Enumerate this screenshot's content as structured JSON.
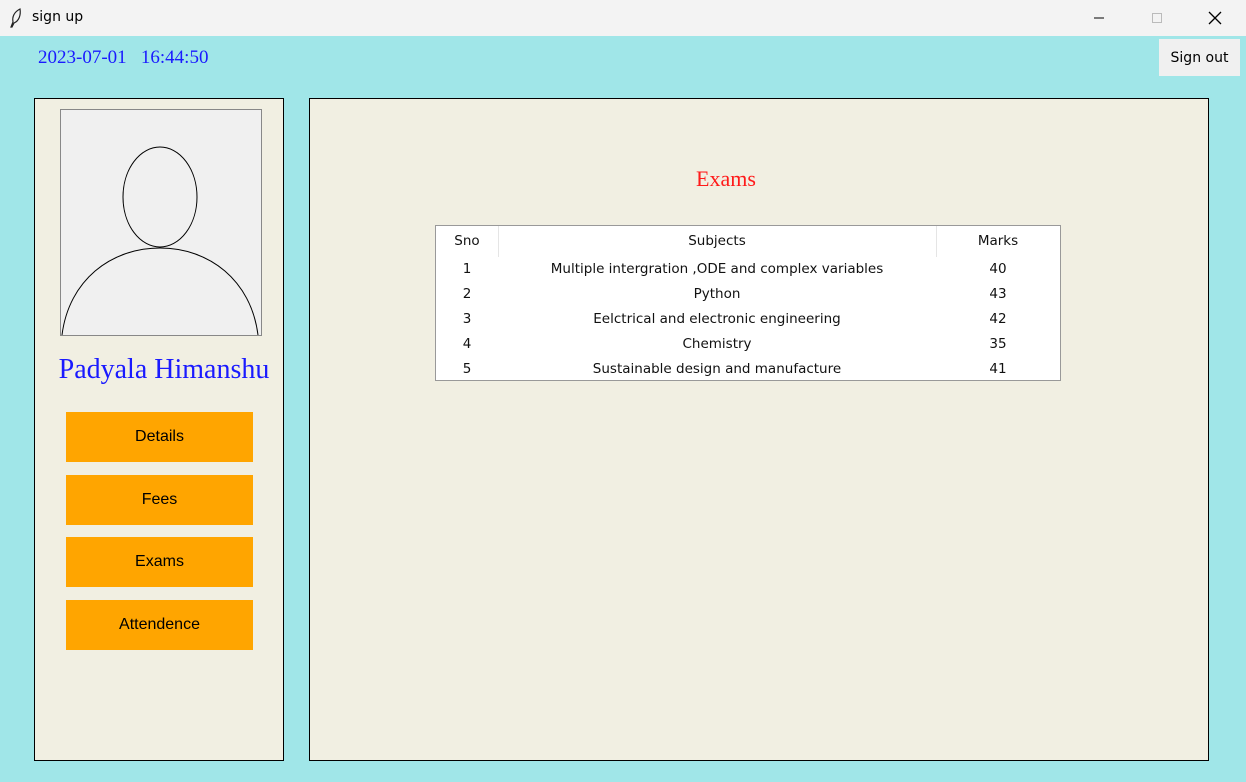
{
  "window": {
    "title": "sign up"
  },
  "header": {
    "date": "2023-07-01",
    "time": "16:44:50",
    "signout_label": "Sign out"
  },
  "sidebar": {
    "user_name": "Padyala Himanshu",
    "buttons": [
      {
        "label": "Details"
      },
      {
        "label": "Fees"
      },
      {
        "label": "Exams"
      },
      {
        "label": "Attendence"
      }
    ]
  },
  "main": {
    "title": "Exams",
    "table": {
      "headers": [
        "Sno",
        "Subjects",
        "Marks"
      ],
      "rows": [
        [
          "1",
          "Multiple intergration ,ODE and complex variables",
          "40"
        ],
        [
          "2",
          "Python",
          "43"
        ],
        [
          "3",
          "Eelctrical and electronic engineering",
          "42"
        ],
        [
          "4",
          "Chemistry",
          "35"
        ],
        [
          "5",
          "Sustainable design and manufacture",
          "41"
        ]
      ]
    }
  },
  "colors": {
    "background": "#a0e6e8",
    "panel": "#f1efe2",
    "button": "#ffa500",
    "name_blue": "#1a1aff",
    "title_red": "#ff1a1a"
  }
}
